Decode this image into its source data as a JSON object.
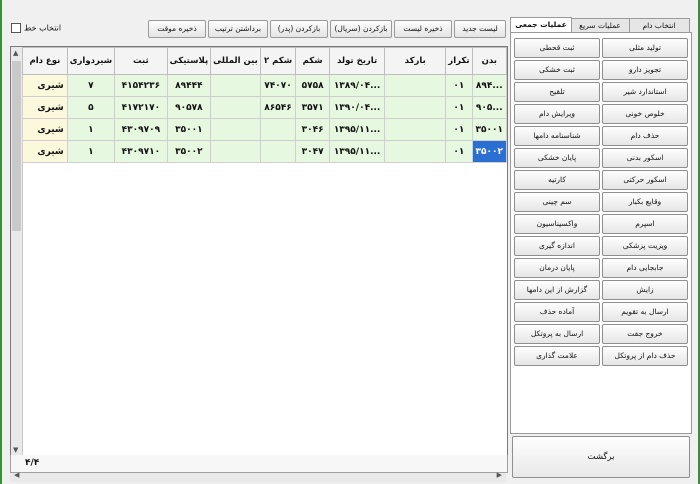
{
  "toolbar": {
    "select_line": "انتخاب خط",
    "buttons": [
      "ذخیره موقت",
      "برداشتن ترتیب",
      "بازکردن (پدر)",
      "بازکردن (سریال)",
      "ذخیره لیست",
      "لیست جدید"
    ]
  },
  "grid": {
    "columns": [
      "بدن",
      "تکرار",
      "بارکد",
      "تاریخ تولد",
      "شکم",
      "شکم ۲",
      "بین المللی",
      "پلاستیکی",
      "ثبت",
      "شیردواری",
      "نوع دام"
    ],
    "rows": [
      [
        "...۸۹۴",
        "۰۱",
        "",
        "...۱۳۸۹/۰۴",
        "۵۷۵۸",
        "۷۴۰۷۰",
        "",
        "۸۹۴۴۴",
        "۴۱۵۴۲۳۶",
        "۷",
        "شیری"
      ],
      [
        "...۹۰۵",
        "۰۱",
        "",
        "...۱۳۹۰/۰۴",
        "۳۵۷۱",
        "۸۶۵۴۶",
        "",
        "۹۰۵۷۸",
        "۴۱۷۲۱۷۰",
        "۵",
        "شیری"
      ],
      [
        "۳۵۰۰۱",
        "۰۱",
        "",
        "...۱۳۹۵/۱۱",
        "۳۰۴۶",
        "",
        "",
        "۳۵۰۰۱",
        "۴۳۰۹۷۰۹",
        "۱",
        "شیری"
      ],
      [
        "۳۵۰۰۲",
        "۰۱",
        "",
        "...۱۳۹۵/۱۱",
        "۳۰۴۷",
        "",
        "",
        "۳۵۰۰۲",
        "۴۳۰۹۷۱۰",
        "۱",
        "شیری"
      ]
    ],
    "record_count": "۴/۴"
  },
  "tabs": [
    "انتخاب دام",
    "عملیات سریع",
    "عملیات جمعی"
  ],
  "actions": [
    [
      "تولید مثلی",
      "ثبت قحطی"
    ],
    [
      "تجویز دارو",
      "ثبت خشکی"
    ],
    [
      "استاندارد شیر",
      "تلقیح"
    ],
    [
      "خلوص خونی",
      "ویرایش دام"
    ],
    [
      "حذف دام",
      "شناسنامه دامها"
    ],
    [
      "اسکور بدنی",
      "پایان خشکی"
    ],
    [
      "اسکور حرکتی",
      "کارتیه"
    ],
    [
      "وقایع بکبار",
      "سم چینی"
    ],
    [
      "اسپرم",
      "واکسیناسیون"
    ],
    [
      "ویزیت پزشکی",
      "اندازه گیری"
    ],
    [
      "جابجایی دام",
      "پایان درمان"
    ],
    [
      "زایش",
      "گزارش از این دامها"
    ],
    [
      "ارسال به تقویم",
      "آماده حذف"
    ],
    [
      "خروج جفت",
      "ارسال به پروتکل"
    ],
    [
      "حذف دام از پروتکل",
      "علامت گذاری"
    ]
  ],
  "back_label": "برگشت"
}
